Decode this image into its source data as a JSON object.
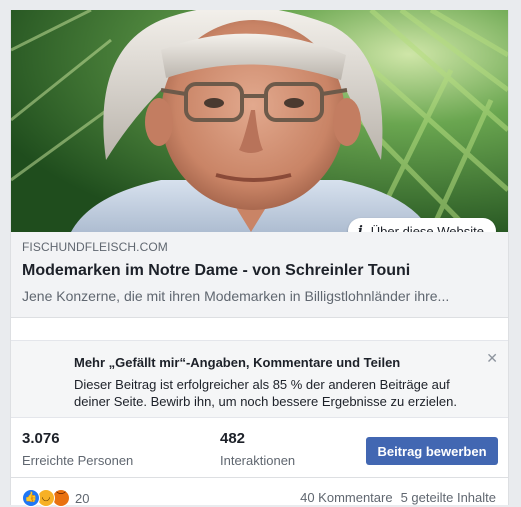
{
  "preview": {
    "image_subject": "portrait-man-glasses",
    "about_label": "Über diese Website",
    "domain": "FISCHUNDFLEISCH.COM",
    "title": "Modemarken im Notre Dame - von Schreinler Touni",
    "description": "Jene Konzerne, die mit ihren Modemarken in Billigstlohnländer ihre..."
  },
  "tip": {
    "title": "Mehr „Gefällt mir“-Angaben, Kommentare und Teilen",
    "text": "Dieser Beitrag ist erfolgreicher als 85 % der anderen Beiträge auf deiner Seite. Bewirb ihn, um noch bessere Ergebnisse zu erzielen.",
    "close_icon": "close-icon"
  },
  "stats": {
    "reach_value": "3.076",
    "reach_label": "Erreichte Personen",
    "interactions_value": "482",
    "interactions_label": "Interaktionen",
    "promote_label": "Beitrag bewerben"
  },
  "footer": {
    "reaction_icons": [
      "like-icon",
      "haha-icon",
      "angry-icon"
    ],
    "reaction_count": "20",
    "comments": "40 Kommentare",
    "shares": "5 geteilte Inhalte"
  },
  "colors": {
    "promote_button": "#4267b2",
    "like": "#2078f4",
    "haha": "#f7b125",
    "angry": "#e9710f"
  }
}
